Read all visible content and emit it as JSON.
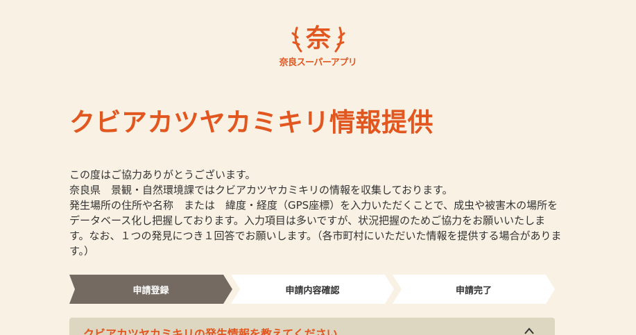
{
  "logo": {
    "mark": "奈",
    "text": "奈良スーパーアプリ",
    "icon": "antler-logo-icon"
  },
  "page_title": "クビアカツヤカミキリ情報提供",
  "intro": [
    "この度はご協力ありがとうございます。",
    "奈良県　景観・自然環境課ではクビアカツヤカミキリの情報を収集しております。",
    "発生場所の住所や名称　または　緯度・経度（GPS座標）を入力いただくことで、成虫や被害木の場所をデータベース化し把握しております。入力項目は多いですが、状況把握のためご協力をお願いいたします。なお、１つの発見につき１回答でお願いします。（各市町村にいただいた情報を提供する場合があります。）"
  ],
  "steps": [
    {
      "label": "申請登録",
      "active": true
    },
    {
      "label": "申請内容確認",
      "active": false
    },
    {
      "label": "申請完了",
      "active": false
    }
  ],
  "section": {
    "title": "クビアカツヤカミキリの発生情報を教えてください",
    "toggle_icon": "chevron-up-icon"
  },
  "colors": {
    "background": "#f8f1e4",
    "accent": "#e2561f",
    "step_active": "#756a62",
    "step_inactive": "#ffffff",
    "section_bg": "#ddd6c0"
  }
}
